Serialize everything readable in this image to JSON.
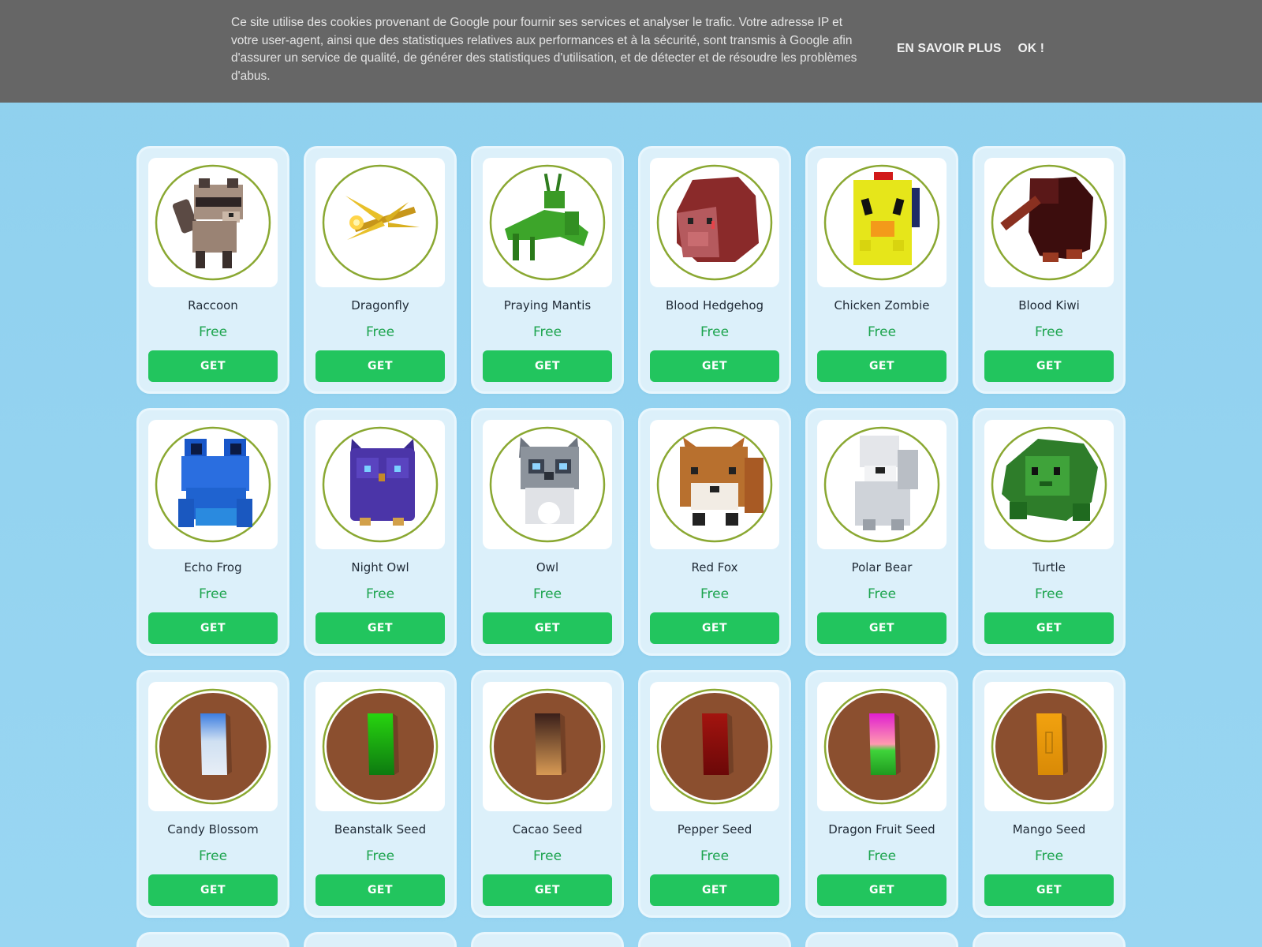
{
  "cookie_banner": {
    "text": "Ce site utilise des cookies provenant de Google pour fournir ses services et analyser le trafic. Votre adresse IP et votre user-agent, ainsi que des statistiques relatives aux performances et à la sécurité, sont transmis à Google afin d'assurer un service de qualité, de générer des statistiques d'utilisation, et de détecter et de résoudre les problèmes d'abus.",
    "learn_more_label": "EN SAVOIR PLUS",
    "ok_label": "OK !"
  },
  "colors": {
    "page_background": "#8fd0ee",
    "card_background": "#dcf0fa",
    "button_green": "#22c55e",
    "price_green": "#1da44e",
    "ring_olive": "#8aa832",
    "seed_soil": "#8b4f2f"
  },
  "items": [
    {
      "name": "Raccoon",
      "price": "Free",
      "button": "GET",
      "icon": "raccoon-icon"
    },
    {
      "name": "Dragonfly",
      "price": "Free",
      "button": "GET",
      "icon": "dragonfly-icon"
    },
    {
      "name": "Praying Mantis",
      "price": "Free",
      "button": "GET",
      "icon": "praying-mantis-icon"
    },
    {
      "name": "Blood Hedgehog",
      "price": "Free",
      "button": "GET",
      "icon": "blood-hedgehog-icon"
    },
    {
      "name": "Chicken Zombie",
      "price": "Free",
      "button": "GET",
      "icon": "chicken-zombie-icon"
    },
    {
      "name": "Blood Kiwi",
      "price": "Free",
      "button": "GET",
      "icon": "blood-kiwi-icon"
    },
    {
      "name": "Echo Frog",
      "price": "Free",
      "button": "GET",
      "icon": "echo-frog-icon"
    },
    {
      "name": "Night Owl",
      "price": "Free",
      "button": "GET",
      "icon": "night-owl-icon"
    },
    {
      "name": "Owl",
      "price": "Free",
      "button": "GET",
      "icon": "owl-icon"
    },
    {
      "name": "Red Fox",
      "price": "Free",
      "button": "GET",
      "icon": "red-fox-icon"
    },
    {
      "name": "Polar Bear",
      "price": "Free",
      "button": "GET",
      "icon": "polar-bear-icon"
    },
    {
      "name": "Turtle",
      "price": "Free",
      "button": "GET",
      "icon": "turtle-icon"
    },
    {
      "name": "Candy Blossom",
      "price": "Free",
      "button": "GET",
      "icon": "candy-blossom-seed-icon"
    },
    {
      "name": "Beanstalk Seed",
      "price": "Free",
      "button": "GET",
      "icon": "beanstalk-seed-icon"
    },
    {
      "name": "Cacao Seed",
      "price": "Free",
      "button": "GET",
      "icon": "cacao-seed-icon"
    },
    {
      "name": "Pepper Seed",
      "price": "Free",
      "button": "GET",
      "icon": "pepper-seed-icon"
    },
    {
      "name": "Dragon Fruit Seed",
      "price": "Free",
      "button": "GET",
      "icon": "dragon-fruit-seed-icon"
    },
    {
      "name": "Mango Seed",
      "price": "Free",
      "button": "GET",
      "icon": "mango-seed-icon"
    }
  ]
}
